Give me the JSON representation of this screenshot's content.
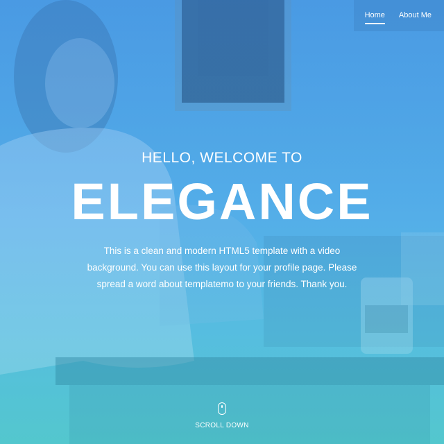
{
  "nav": {
    "items": [
      {
        "label": "Home",
        "active": true
      },
      {
        "label": "About Me",
        "active": false
      }
    ]
  },
  "hero": {
    "subtitle": "HELLO, WELCOME TO",
    "title": "ELEGANCE",
    "description": "This is a clean and modern HTML5 template with a video background. You can use this layout for your profile page. Please spread a word about templatemo to your friends. Thank you."
  },
  "scroll": {
    "label": "SCROLL DOWN",
    "icon": "mouse-icon"
  },
  "colors": {
    "overlay_top": "#4e9fe0",
    "overlay_bottom": "#57c6c8",
    "text": "#ffffff"
  }
}
